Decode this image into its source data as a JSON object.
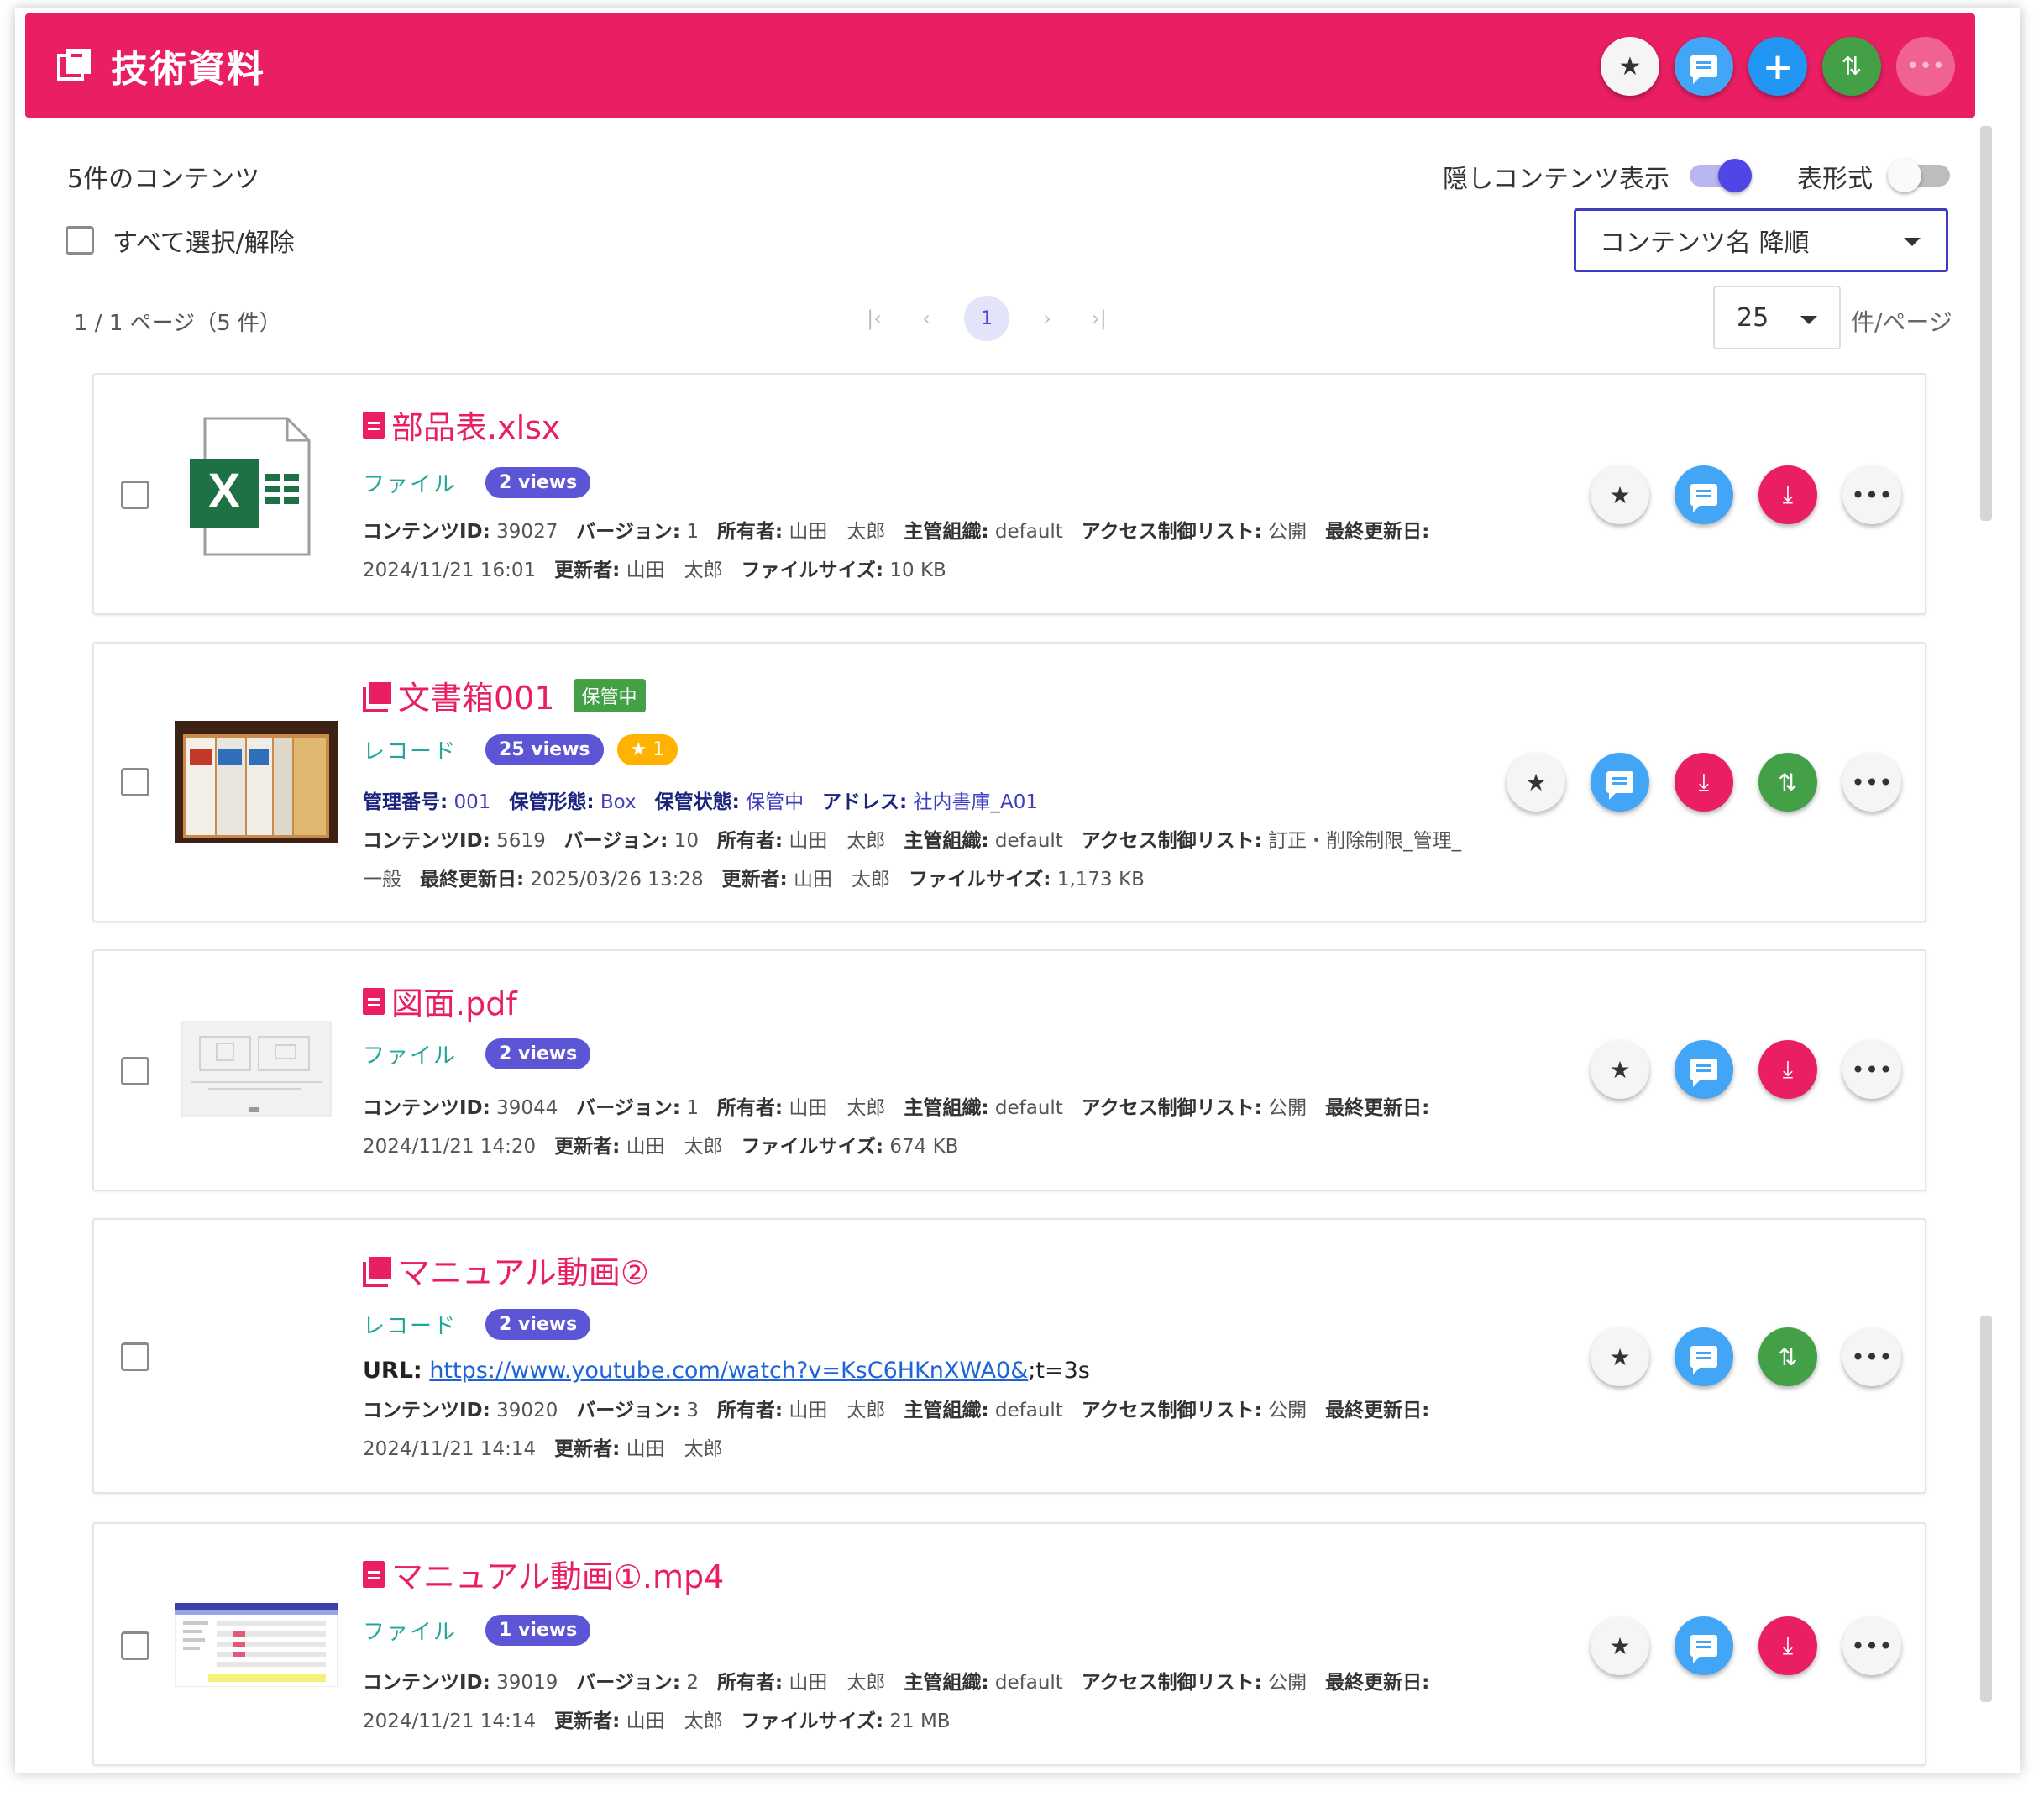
{
  "header": {
    "title": "技術資料",
    "actions": [
      "star-icon",
      "chat-icon",
      "plus-icon",
      "swap-icon",
      "more-icon"
    ],
    "colors": {
      "brand": "#e91e63"
    }
  },
  "toolbar": {
    "count_text": "5件のコンテンツ",
    "hidden_content_label": "隠しコンテンツ表示",
    "hidden_content_on": true,
    "table_format_label": "表形式",
    "table_format_on": false,
    "select_all_label": "すべて選択/解除",
    "sort_value": "コンテンツ名 降順"
  },
  "pagination": {
    "page_info": "1 / 1 ページ（5 件）",
    "current_page": "1",
    "per_page_value": "25",
    "per_page_label": "件/ページ"
  },
  "items": [
    {
      "title": "部品表.xlsx",
      "type": "ファイル",
      "views": "2 views",
      "icon": "file-icon",
      "info_line1": [
        [
          "コンテンツID:",
          "39027"
        ],
        [
          "バージョン:",
          "1"
        ],
        [
          "所有者:",
          "山田　太郎"
        ],
        [
          "主管組織:",
          "default"
        ],
        [
          "アクセス制御リスト:",
          "公開"
        ],
        [
          "最終更新日:",
          ""
        ]
      ],
      "info_line2": [
        [
          "",
          "2024/11/21 16:01"
        ],
        [
          "更新者:",
          "山田　太郎"
        ],
        [
          "ファイルサイズ:",
          "10 KB"
        ]
      ],
      "actions": [
        "star",
        "chat",
        "download",
        "more"
      ]
    },
    {
      "title": "文書箱001",
      "status": "保管中",
      "type": "レコード",
      "views": "25 views",
      "stars": "★ 1",
      "icon": "record-icon",
      "record_line": [
        [
          "管理番号:",
          "001"
        ],
        [
          "保管形態:",
          "Box"
        ],
        [
          "保管状態:",
          "保管中"
        ],
        [
          "アドレス:",
          "社内書庫_A01"
        ]
      ],
      "info_line1": [
        [
          "コンテンツID:",
          "5619"
        ],
        [
          "バージョン:",
          "10"
        ],
        [
          "所有者:",
          "山田　太郎"
        ],
        [
          "主管組織:",
          "default"
        ],
        [
          "アクセス制御リスト:",
          "訂正・削除制限_管理_"
        ]
      ],
      "info_line2": [
        [
          "",
          "一般"
        ],
        [
          "最終更新日:",
          "2025/03/26 13:28"
        ],
        [
          "更新者:",
          "山田　太郎"
        ],
        [
          "ファイルサイズ:",
          "1,173 KB"
        ]
      ],
      "actions": [
        "star",
        "chat",
        "download",
        "swap",
        "more"
      ]
    },
    {
      "title": "図面.pdf",
      "type": "ファイル",
      "views": "2 views",
      "icon": "file-icon",
      "info_line1": [
        [
          "コンテンツID:",
          "39044"
        ],
        [
          "バージョン:",
          "1"
        ],
        [
          "所有者:",
          "山田　太郎"
        ],
        [
          "主管組織:",
          "default"
        ],
        [
          "アクセス制御リスト:",
          "公開"
        ],
        [
          "最終更新日:",
          ""
        ]
      ],
      "info_line2": [
        [
          "",
          "2024/11/21 14:20"
        ],
        [
          "更新者:",
          "山田　太郎"
        ],
        [
          "ファイルサイズ:",
          "674 KB"
        ]
      ],
      "actions": [
        "star",
        "chat",
        "download",
        "more"
      ]
    },
    {
      "title": "マニュアル動画②",
      "type": "レコード",
      "views": "2 views",
      "icon": "record-icon",
      "url_label": "URL:",
      "url_link": "https://www.youtube.com/watch?v=KsC6HKnXWA0&",
      "url_suffix": ";t=3s",
      "info_line1": [
        [
          "コンテンツID:",
          "39020"
        ],
        [
          "バージョン:",
          "3"
        ],
        [
          "所有者:",
          "山田　太郎"
        ],
        [
          "主管組織:",
          "default"
        ],
        [
          "アクセス制御リスト:",
          "公開"
        ],
        [
          "最終更新日:",
          ""
        ]
      ],
      "info_line2": [
        [
          "",
          "2024/11/21 14:14"
        ],
        [
          "更新者:",
          "山田　太郎"
        ]
      ],
      "actions": [
        "star",
        "chat",
        "swap",
        "more"
      ]
    },
    {
      "title": "マニュアル動画①.mp4",
      "type": "ファイル",
      "views": "1 views",
      "icon": "file-icon",
      "info_line1": [
        [
          "コンテンツID:",
          "39019"
        ],
        [
          "バージョン:",
          "2"
        ],
        [
          "所有者:",
          "山田　太郎"
        ],
        [
          "主管組織:",
          "default"
        ],
        [
          "アクセス制御リスト:",
          "公開"
        ],
        [
          "最終更新日:",
          ""
        ]
      ],
      "info_line2": [
        [
          "",
          "2024/11/21 14:14"
        ],
        [
          "更新者:",
          "山田　太郎"
        ],
        [
          "ファイルサイズ:",
          "21 MB"
        ]
      ],
      "actions": [
        "star",
        "chat",
        "download",
        "more"
      ]
    }
  ]
}
